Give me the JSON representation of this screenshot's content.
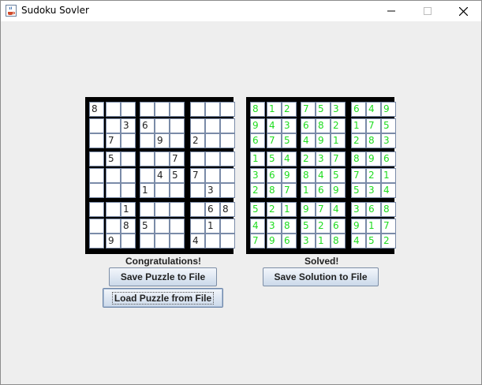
{
  "window": {
    "title": "Sudoku Sovler",
    "icons": {
      "app": "java-cup-icon",
      "minimize": "minimize-icon",
      "maximize": "maximize-icon",
      "close": "close-icon"
    }
  },
  "colors": {
    "solution_digit": "#1fdc1f",
    "puzzle_digit": "#222222",
    "board_bg": "#000000",
    "cell_border": "#7a8ba8"
  },
  "puzzle": {
    "grid": [
      [
        "8",
        "",
        "",
        "",
        "",
        "",
        "",
        "",
        ""
      ],
      [
        "",
        "",
        "3",
        "6",
        "",
        "",
        "",
        "",
        ""
      ],
      [
        "",
        "7",
        "",
        "",
        "9",
        "",
        "2",
        "",
        ""
      ],
      [
        "",
        "5",
        "",
        "",
        "",
        "7",
        "",
        "",
        ""
      ],
      [
        "",
        "",
        "",
        "",
        "4",
        "5",
        "7",
        "",
        ""
      ],
      [
        "",
        "",
        "",
        "1",
        "",
        "",
        "",
        "3",
        ""
      ],
      [
        "",
        "",
        "1",
        "",
        "",
        "",
        "",
        "6",
        "8"
      ],
      [
        "",
        "",
        "8",
        "5",
        "",
        "",
        "",
        "1",
        ""
      ],
      [
        "",
        "9",
        "",
        "",
        "",
        "",
        "4",
        "",
        ""
      ]
    ]
  },
  "solution": {
    "grid": [
      [
        "8",
        "1",
        "2",
        "7",
        "5",
        "3",
        "6",
        "4",
        "9"
      ],
      [
        "9",
        "4",
        "3",
        "6",
        "8",
        "2",
        "1",
        "7",
        "5"
      ],
      [
        "6",
        "7",
        "5",
        "4",
        "9",
        "1",
        "2",
        "8",
        "3"
      ],
      [
        "1",
        "5",
        "4",
        "2",
        "3",
        "7",
        "8",
        "9",
        "6"
      ],
      [
        "3",
        "6",
        "9",
        "8",
        "4",
        "5",
        "7",
        "2",
        "1"
      ],
      [
        "2",
        "8",
        "7",
        "1",
        "6",
        "9",
        "5",
        "3",
        "4"
      ],
      [
        "5",
        "2",
        "1",
        "9",
        "7",
        "4",
        "3",
        "6",
        "8"
      ],
      [
        "4",
        "3",
        "8",
        "5",
        "2",
        "6",
        "9",
        "1",
        "7"
      ],
      [
        "7",
        "9",
        "6",
        "3",
        "1",
        "8",
        "4",
        "5",
        "2"
      ]
    ]
  },
  "status": {
    "left": "Congratulations!",
    "right": "Solved!"
  },
  "buttons": {
    "save_puzzle": "Save Puzzle to File",
    "save_solution": "Save Solution to File",
    "load_puzzle": "Load Puzzle from File"
  }
}
